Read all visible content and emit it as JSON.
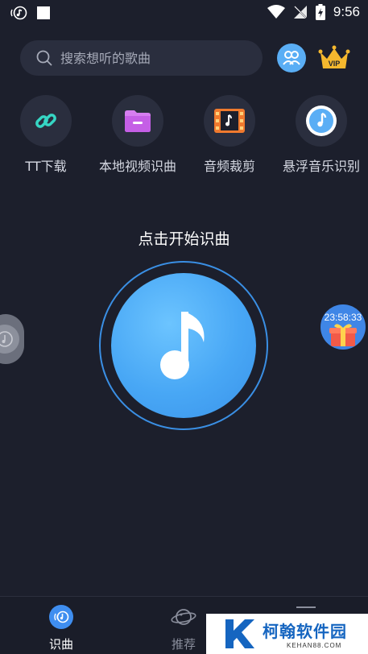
{
  "status_bar": {
    "time": "9:56"
  },
  "search": {
    "placeholder": "搜索想听的歌曲"
  },
  "tools": [
    {
      "label": "TT下载",
      "icon": "link-icon"
    },
    {
      "label": "本地视频识曲",
      "icon": "folder-icon"
    },
    {
      "label": "音频裁剪",
      "icon": "film-music-icon"
    },
    {
      "label": "悬浮音乐识别",
      "icon": "floating-music-icon"
    }
  ],
  "main": {
    "hint": "点击开始识曲"
  },
  "gift": {
    "countdown": "23:58:33"
  },
  "header": {
    "vip_badge": "VIP"
  },
  "bottom_nav": {
    "items": [
      {
        "label": "识曲",
        "icon": "recognize-icon",
        "active": true
      },
      {
        "label": "推荐",
        "icon": "planet-icon",
        "active": false
      },
      {
        "label": "",
        "icon": "menu-icon",
        "active": false
      }
    ]
  },
  "watermark": {
    "title": "柯翰软件园",
    "subtitle": "KEHAN88.COM"
  },
  "colors": {
    "background": "#1c1f2c",
    "accent": "#48a7f5",
    "surface": "#2a2e3e"
  }
}
